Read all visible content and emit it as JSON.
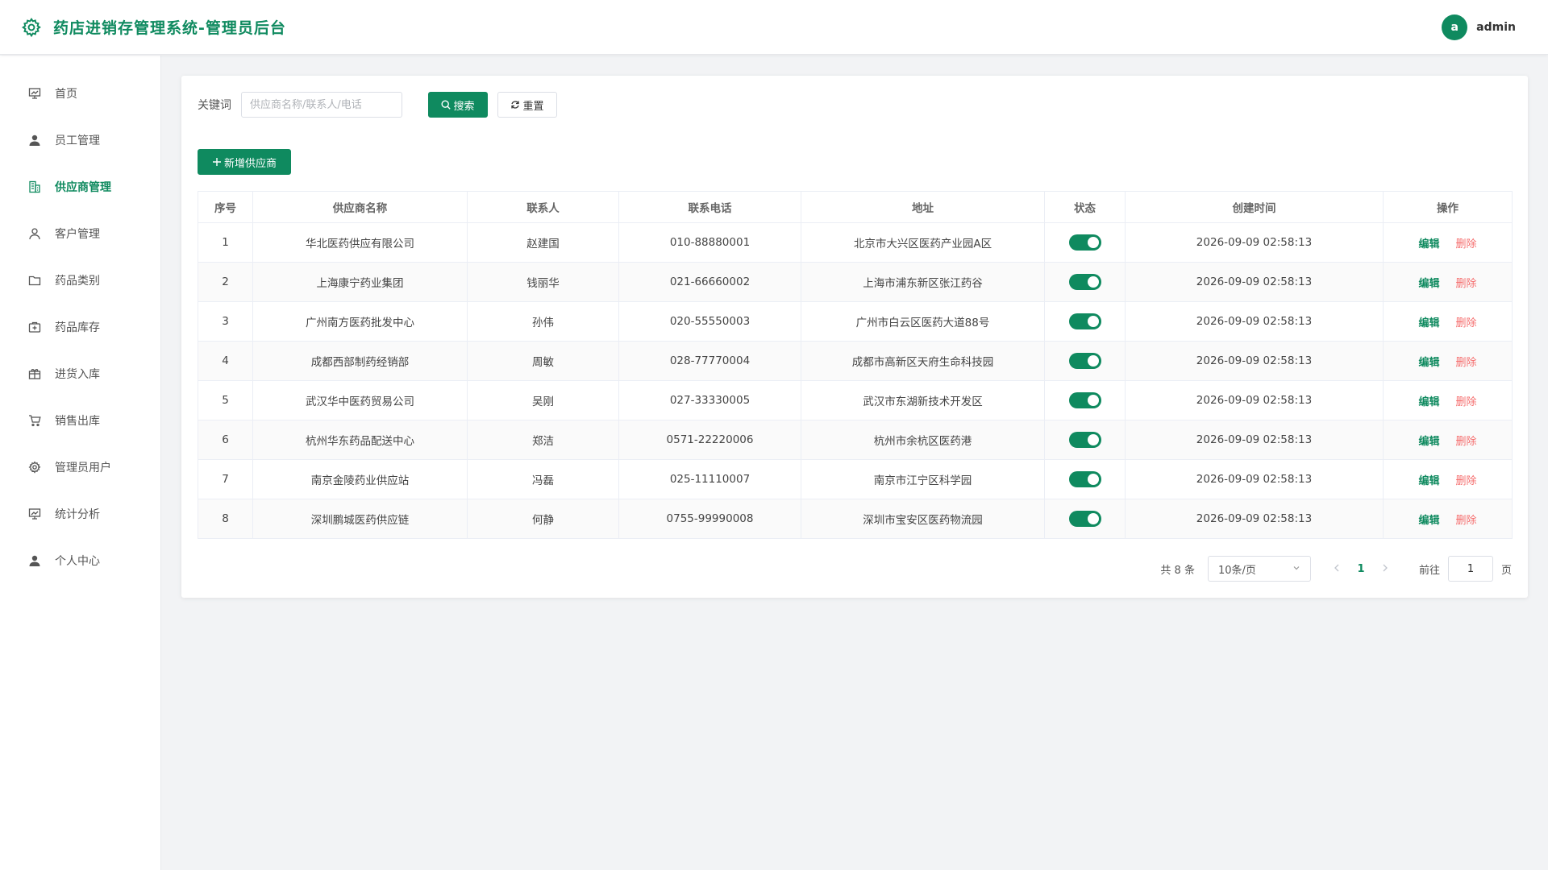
{
  "header": {
    "title": "药店进销存管理系统-管理员后台",
    "logo_icon": "gear-icon",
    "avatar_letter": "a",
    "username": "admin"
  },
  "colors": {
    "primary": "#0f8a5f",
    "danger": "#f56c6c"
  },
  "sidebar": {
    "items": [
      {
        "label": "首页",
        "icon": "dashboard-icon"
      },
      {
        "label": "员工管理",
        "icon": "user-icon"
      },
      {
        "label": "供应商管理",
        "icon": "building-icon",
        "active": true
      },
      {
        "label": "客户管理",
        "icon": "user-outline-icon"
      },
      {
        "label": "药品类别",
        "icon": "folder-icon"
      },
      {
        "label": "药品库存",
        "icon": "medicine-box-icon"
      },
      {
        "label": "进货入库",
        "icon": "gift-box-icon"
      },
      {
        "label": "销售出库",
        "icon": "cart-icon"
      },
      {
        "label": "管理员用户",
        "icon": "gear-icon"
      },
      {
        "label": "统计分析",
        "icon": "chart-icon"
      },
      {
        "label": "个人中心",
        "icon": "user-icon"
      }
    ]
  },
  "search": {
    "label": "关键词",
    "placeholder": "供应商名称/联系人/电话",
    "value": "",
    "search_label": "搜索",
    "reset_label": "重置"
  },
  "toolbar": {
    "add_label": "新增供应商"
  },
  "table": {
    "columns": [
      "序号",
      "供应商名称",
      "联系人",
      "联系电话",
      "地址",
      "状态",
      "创建时间",
      "操作"
    ],
    "edit_label": "编辑",
    "delete_label": "删除",
    "rows": [
      {
        "no": "1",
        "name": "华北医药供应有限公司",
        "contact": "赵建国",
        "phone": "010-88880001",
        "address": "北京市大兴区医药产业园A区",
        "enabled": true,
        "created": "2026-09-09 02:58:13"
      },
      {
        "no": "2",
        "name": "上海康宁药业集团",
        "contact": "钱丽华",
        "phone": "021-66660002",
        "address": "上海市浦东新区张江药谷",
        "enabled": true,
        "created": "2026-09-09 02:58:13"
      },
      {
        "no": "3",
        "name": "广州南方医药批发中心",
        "contact": "孙伟",
        "phone": "020-55550003",
        "address": "广州市白云区医药大道88号",
        "enabled": true,
        "created": "2026-09-09 02:58:13"
      },
      {
        "no": "4",
        "name": "成都西部制药经销部",
        "contact": "周敏",
        "phone": "028-77770004",
        "address": "成都市高新区天府生命科技园",
        "enabled": true,
        "created": "2026-09-09 02:58:13"
      },
      {
        "no": "5",
        "name": "武汉华中医药贸易公司",
        "contact": "吴刚",
        "phone": "027-33330005",
        "address": "武汉市东湖新技术开发区",
        "enabled": true,
        "created": "2026-09-09 02:58:13"
      },
      {
        "no": "6",
        "name": "杭州华东药品配送中心",
        "contact": "郑洁",
        "phone": "0571-22220006",
        "address": "杭州市余杭区医药港",
        "enabled": true,
        "created": "2026-09-09 02:58:13"
      },
      {
        "no": "7",
        "name": "南京金陵药业供应站",
        "contact": "冯磊",
        "phone": "025-11110007",
        "address": "南京市江宁区科学园",
        "enabled": true,
        "created": "2026-09-09 02:58:13"
      },
      {
        "no": "8",
        "name": "深圳鹏城医药供应链",
        "contact": "何静",
        "phone": "0755-99990008",
        "address": "深圳市宝安区医药物流园",
        "enabled": true,
        "created": "2026-09-09 02:58:13"
      }
    ]
  },
  "pagination": {
    "total_label": "共 8 条",
    "page_size_label": "10条/页",
    "current_page": "1",
    "goto_label": "前往",
    "goto_value": "1",
    "goto_suffix": "页"
  }
}
